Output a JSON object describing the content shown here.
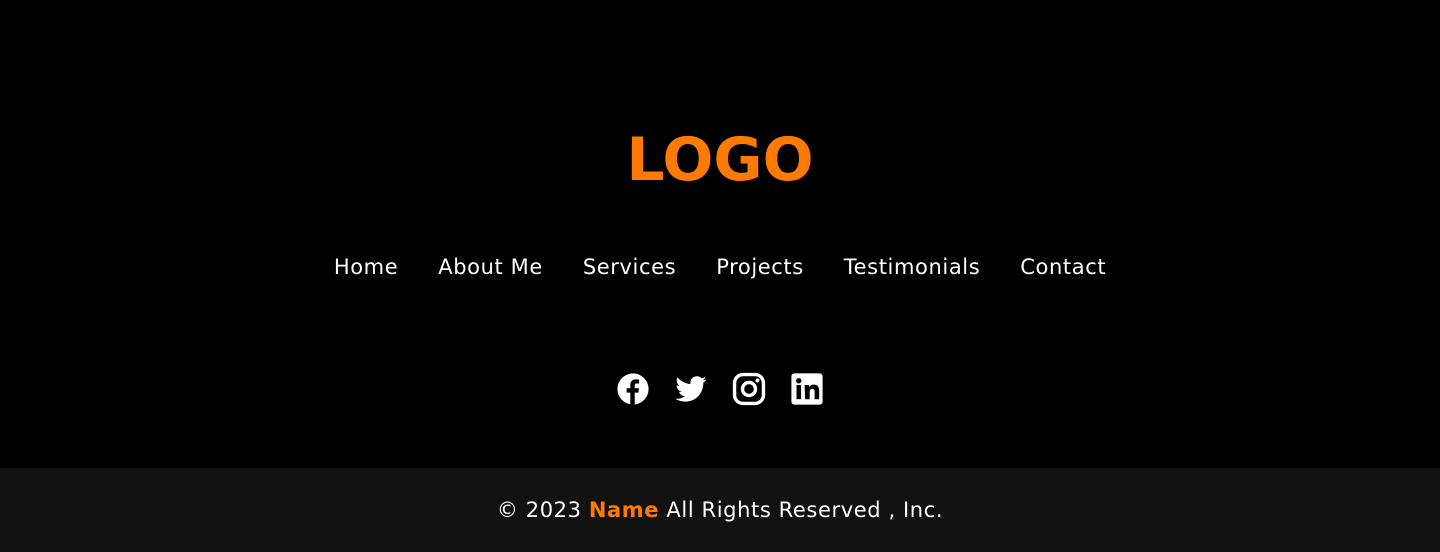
{
  "brand": {
    "logo_text": "LOGO",
    "accent_color": "#ff7a00"
  },
  "nav": {
    "items": [
      {
        "label": "Home"
      },
      {
        "label": "About Me"
      },
      {
        "label": "Services"
      },
      {
        "label": "Projects"
      },
      {
        "label": "Testimonials"
      },
      {
        "label": "Contact"
      }
    ]
  },
  "social": {
    "icons": [
      "facebook-icon",
      "twitter-icon",
      "instagram-icon",
      "linkedin-icon"
    ]
  },
  "footer": {
    "copyright_prefix": "© 2023",
    "copyright_name": "Name",
    "copyright_suffix": "All Rights Reserved , Inc.",
    "background_color": "#121212"
  }
}
